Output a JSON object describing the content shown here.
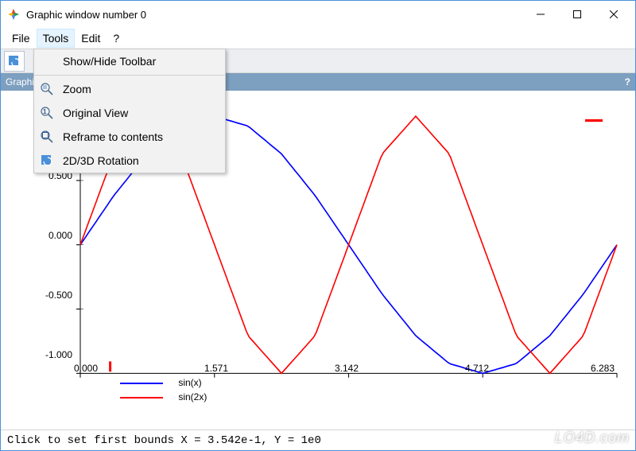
{
  "titlebar": {
    "title": "Graphic window number 0"
  },
  "menubar": {
    "items": [
      "File",
      "Tools",
      "Edit",
      "?"
    ],
    "open_index": 1
  },
  "tools_menu": {
    "items": [
      {
        "label": "Show/Hide Toolbar",
        "icon": ""
      },
      {
        "label": "Zoom",
        "icon": "zoom"
      },
      {
        "label": "Original View",
        "icon": "original-view"
      },
      {
        "label": "Reframe to contents",
        "icon": "reframe"
      },
      {
        "label": "2D/3D Rotation",
        "icon": "rotation"
      }
    ]
  },
  "graphics_bar": {
    "label": "Graphics",
    "help": "?"
  },
  "chart_data": {
    "type": "line",
    "x": [
      0,
      0.393,
      0.785,
      1.178,
      1.571,
      1.963,
      2.356,
      2.749,
      3.142,
      3.534,
      3.927,
      4.32,
      4.712,
      5.105,
      5.498,
      5.89,
      6.283
    ],
    "series": [
      {
        "name": "sin(x)",
        "color": "#0000ff",
        "values": [
          0.0,
          0.383,
          0.707,
          0.924,
          1.0,
          0.924,
          0.707,
          0.383,
          0.0,
          -0.383,
          -0.707,
          -0.924,
          -1.0,
          -0.924,
          -0.707,
          -0.383,
          0.0
        ]
      },
      {
        "name": "sin(2x)",
        "color": "#ff0000",
        "values": [
          0.0,
          0.707,
          1.0,
          0.707,
          0.0,
          -0.707,
          -1.0,
          -0.707,
          0.0,
          0.707,
          1.0,
          0.707,
          0.0,
          -0.707,
          -1.0,
          -0.707,
          0.0
        ]
      }
    ],
    "xlim": [
      0,
      6.283
    ],
    "ylim": [
      -1.0,
      1.0
    ],
    "xticks": [
      0.0,
      1.571,
      3.142,
      4.712,
      6.283
    ],
    "xtick_labels": [
      "0.000",
      "1.571",
      "3.142",
      "4.712",
      "6.283"
    ],
    "yticks": [
      -1.0,
      -0.5,
      0.0,
      0.5
    ],
    "ytick_labels": [
      "-1.000",
      "-0.500",
      "0.000",
      "0.500"
    ],
    "legend_pos": "bottom"
  },
  "status_bar": {
    "text": "Click to set first bounds X = 3.542e-1, Y = 1e0"
  },
  "watermark": "LO4D.com"
}
